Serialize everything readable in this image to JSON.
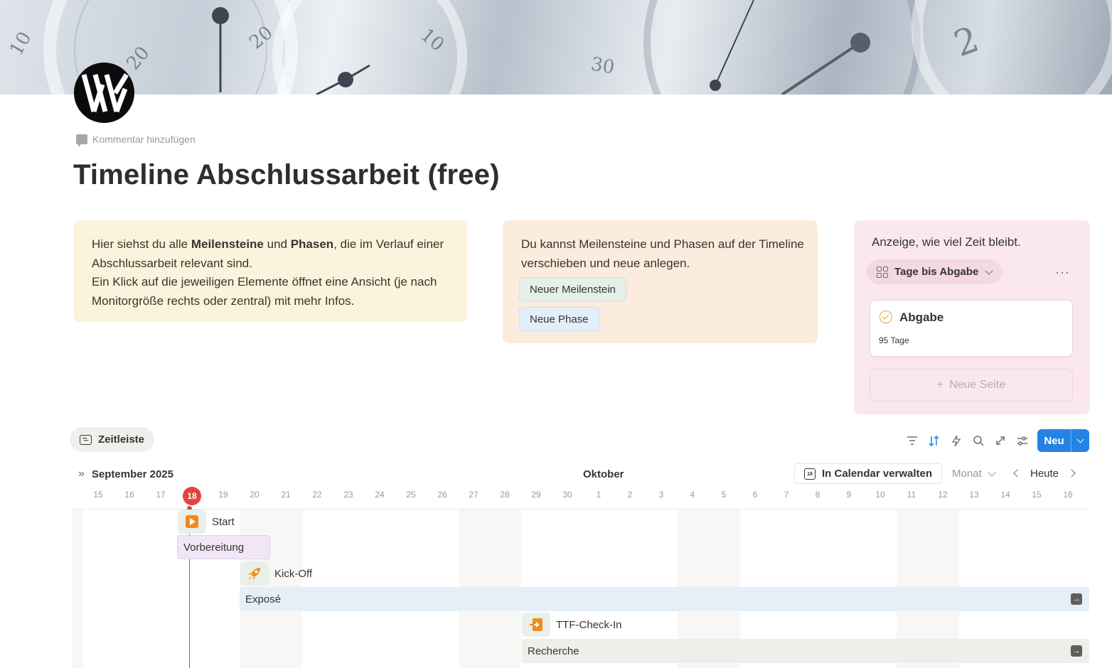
{
  "page": {
    "comment_label": "Kommentar hinzufügen",
    "title": "Timeline Abschlussarbeit (free)"
  },
  "callouts": {
    "info": {
      "p1_a": "Hier siehst du alle ",
      "p1_b": "Meilensteine",
      "p1_c": " und ",
      "p1_d": "Phasen",
      "p1_e": ", die im Verlauf einer Abschlussarbeit relevant sind.",
      "p2": "Ein Klick auf die jeweiligen Elemente öffnet eine Ansicht (je nach Monitorgröße rechts oder zentral) mit mehr Infos."
    },
    "actions": {
      "text": "Du kannst Meilensteine und Phasen auf der Timeline verschieben und neue anlegen.",
      "btn_milestone": "Neuer Meilenstein",
      "btn_phase": "Neue Phase"
    },
    "countdown": {
      "text": "Anzeige, wie viel Zeit bleibt.",
      "view_label": "Tage bis Abgabe",
      "more": "···",
      "card_name": "Abgabe",
      "card_value": "95 Tage",
      "new_page": "Neue Seite"
    }
  },
  "timeline": {
    "tab_label": "Zeitleiste",
    "new_button": "Neu",
    "month_left": "September 2025",
    "month_mid": "Oktober",
    "calendar_button": "In Calendar verwalten",
    "scale": "Monat",
    "today_button": "Heute",
    "today_day": "18",
    "days": [
      "15",
      "16",
      "17",
      "18",
      "19",
      "20",
      "21",
      "22",
      "23",
      "24",
      "25",
      "26",
      "27",
      "28",
      "29",
      "30",
      "1",
      "2",
      "3",
      "4",
      "5",
      "6",
      "7",
      "8",
      "9",
      "10",
      "11",
      "12",
      "13",
      "14",
      "15",
      "16"
    ],
    "items": {
      "start": "Start",
      "vorbereitung": "Vorbereitung",
      "kickoff": "Kick-Off",
      "expose": "Exposé",
      "ttf": "TTF-Check-In",
      "recherche": "Recherche"
    }
  },
  "colors": {
    "accent": "#2383e2",
    "today": "#e0463d",
    "callout_yellow": "#fbf3db",
    "callout_orange": "#fbecdd",
    "callout_pink": "#fae8ee"
  }
}
